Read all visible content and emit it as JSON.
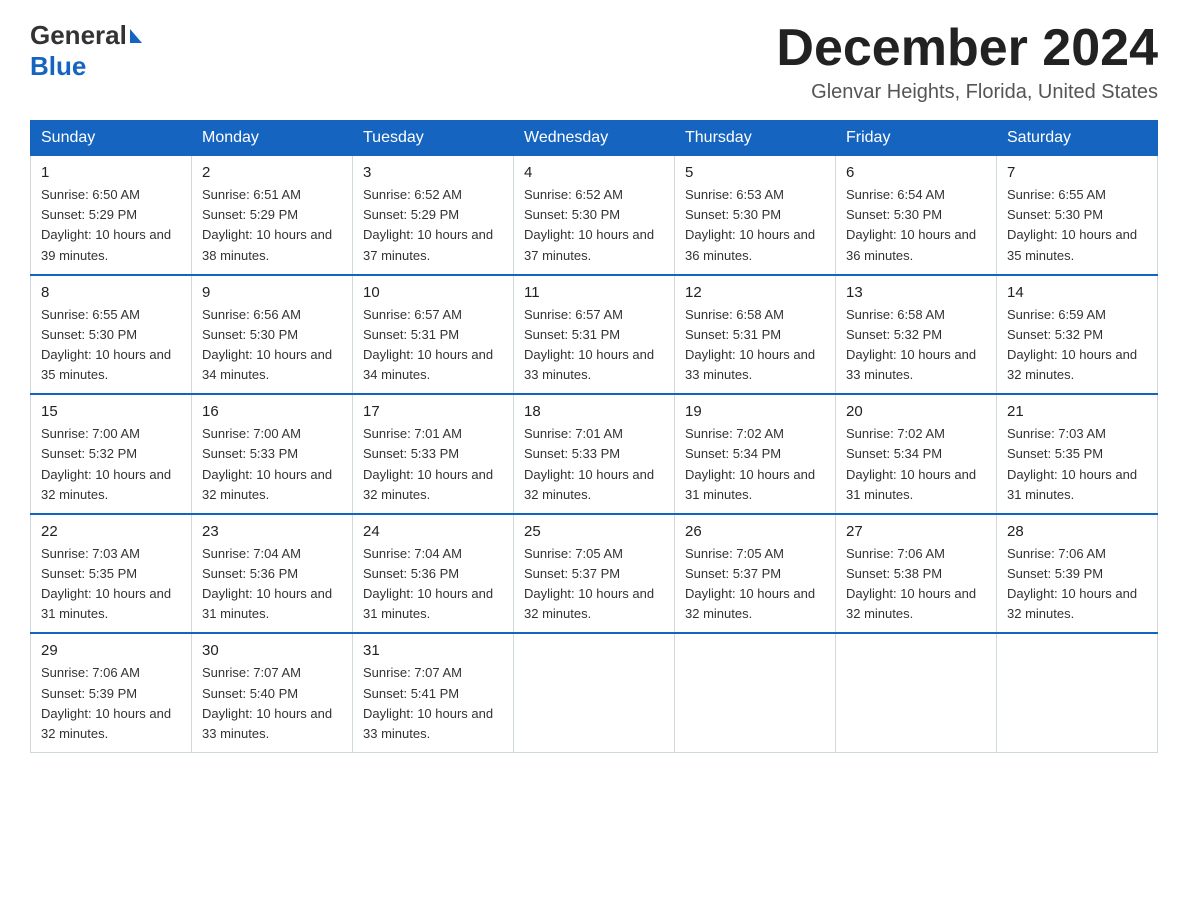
{
  "header": {
    "logo_general": "General",
    "logo_blue": "Blue",
    "month_title": "December 2024",
    "location": "Glenvar Heights, Florida, United States"
  },
  "weekdays": [
    "Sunday",
    "Monday",
    "Tuesday",
    "Wednesday",
    "Thursday",
    "Friday",
    "Saturday"
  ],
  "weeks": [
    [
      {
        "day": "1",
        "sunrise": "6:50 AM",
        "sunset": "5:29 PM",
        "daylight": "10 hours and 39 minutes."
      },
      {
        "day": "2",
        "sunrise": "6:51 AM",
        "sunset": "5:29 PM",
        "daylight": "10 hours and 38 minutes."
      },
      {
        "day": "3",
        "sunrise": "6:52 AM",
        "sunset": "5:29 PM",
        "daylight": "10 hours and 37 minutes."
      },
      {
        "day": "4",
        "sunrise": "6:52 AM",
        "sunset": "5:30 PM",
        "daylight": "10 hours and 37 minutes."
      },
      {
        "day": "5",
        "sunrise": "6:53 AM",
        "sunset": "5:30 PM",
        "daylight": "10 hours and 36 minutes."
      },
      {
        "day": "6",
        "sunrise": "6:54 AM",
        "sunset": "5:30 PM",
        "daylight": "10 hours and 36 minutes."
      },
      {
        "day": "7",
        "sunrise": "6:55 AM",
        "sunset": "5:30 PM",
        "daylight": "10 hours and 35 minutes."
      }
    ],
    [
      {
        "day": "8",
        "sunrise": "6:55 AM",
        "sunset": "5:30 PM",
        "daylight": "10 hours and 35 minutes."
      },
      {
        "day": "9",
        "sunrise": "6:56 AM",
        "sunset": "5:30 PM",
        "daylight": "10 hours and 34 minutes."
      },
      {
        "day": "10",
        "sunrise": "6:57 AM",
        "sunset": "5:31 PM",
        "daylight": "10 hours and 34 minutes."
      },
      {
        "day": "11",
        "sunrise": "6:57 AM",
        "sunset": "5:31 PM",
        "daylight": "10 hours and 33 minutes."
      },
      {
        "day": "12",
        "sunrise": "6:58 AM",
        "sunset": "5:31 PM",
        "daylight": "10 hours and 33 minutes."
      },
      {
        "day": "13",
        "sunrise": "6:58 AM",
        "sunset": "5:32 PM",
        "daylight": "10 hours and 33 minutes."
      },
      {
        "day": "14",
        "sunrise": "6:59 AM",
        "sunset": "5:32 PM",
        "daylight": "10 hours and 32 minutes."
      }
    ],
    [
      {
        "day": "15",
        "sunrise": "7:00 AM",
        "sunset": "5:32 PM",
        "daylight": "10 hours and 32 minutes."
      },
      {
        "day": "16",
        "sunrise": "7:00 AM",
        "sunset": "5:33 PM",
        "daylight": "10 hours and 32 minutes."
      },
      {
        "day": "17",
        "sunrise": "7:01 AM",
        "sunset": "5:33 PM",
        "daylight": "10 hours and 32 minutes."
      },
      {
        "day": "18",
        "sunrise": "7:01 AM",
        "sunset": "5:33 PM",
        "daylight": "10 hours and 32 minutes."
      },
      {
        "day": "19",
        "sunrise": "7:02 AM",
        "sunset": "5:34 PM",
        "daylight": "10 hours and 31 minutes."
      },
      {
        "day": "20",
        "sunrise": "7:02 AM",
        "sunset": "5:34 PM",
        "daylight": "10 hours and 31 minutes."
      },
      {
        "day": "21",
        "sunrise": "7:03 AM",
        "sunset": "5:35 PM",
        "daylight": "10 hours and 31 minutes."
      }
    ],
    [
      {
        "day": "22",
        "sunrise": "7:03 AM",
        "sunset": "5:35 PM",
        "daylight": "10 hours and 31 minutes."
      },
      {
        "day": "23",
        "sunrise": "7:04 AM",
        "sunset": "5:36 PM",
        "daylight": "10 hours and 31 minutes."
      },
      {
        "day": "24",
        "sunrise": "7:04 AM",
        "sunset": "5:36 PM",
        "daylight": "10 hours and 31 minutes."
      },
      {
        "day": "25",
        "sunrise": "7:05 AM",
        "sunset": "5:37 PM",
        "daylight": "10 hours and 32 minutes."
      },
      {
        "day": "26",
        "sunrise": "7:05 AM",
        "sunset": "5:37 PM",
        "daylight": "10 hours and 32 minutes."
      },
      {
        "day": "27",
        "sunrise": "7:06 AM",
        "sunset": "5:38 PM",
        "daylight": "10 hours and 32 minutes."
      },
      {
        "day": "28",
        "sunrise": "7:06 AM",
        "sunset": "5:39 PM",
        "daylight": "10 hours and 32 minutes."
      }
    ],
    [
      {
        "day": "29",
        "sunrise": "7:06 AM",
        "sunset": "5:39 PM",
        "daylight": "10 hours and 32 minutes."
      },
      {
        "day": "30",
        "sunrise": "7:07 AM",
        "sunset": "5:40 PM",
        "daylight": "10 hours and 33 minutes."
      },
      {
        "day": "31",
        "sunrise": "7:07 AM",
        "sunset": "5:41 PM",
        "daylight": "10 hours and 33 minutes."
      },
      null,
      null,
      null,
      null
    ]
  ],
  "labels": {
    "sunrise": "Sunrise:",
    "sunset": "Sunset:",
    "daylight": "Daylight:"
  }
}
